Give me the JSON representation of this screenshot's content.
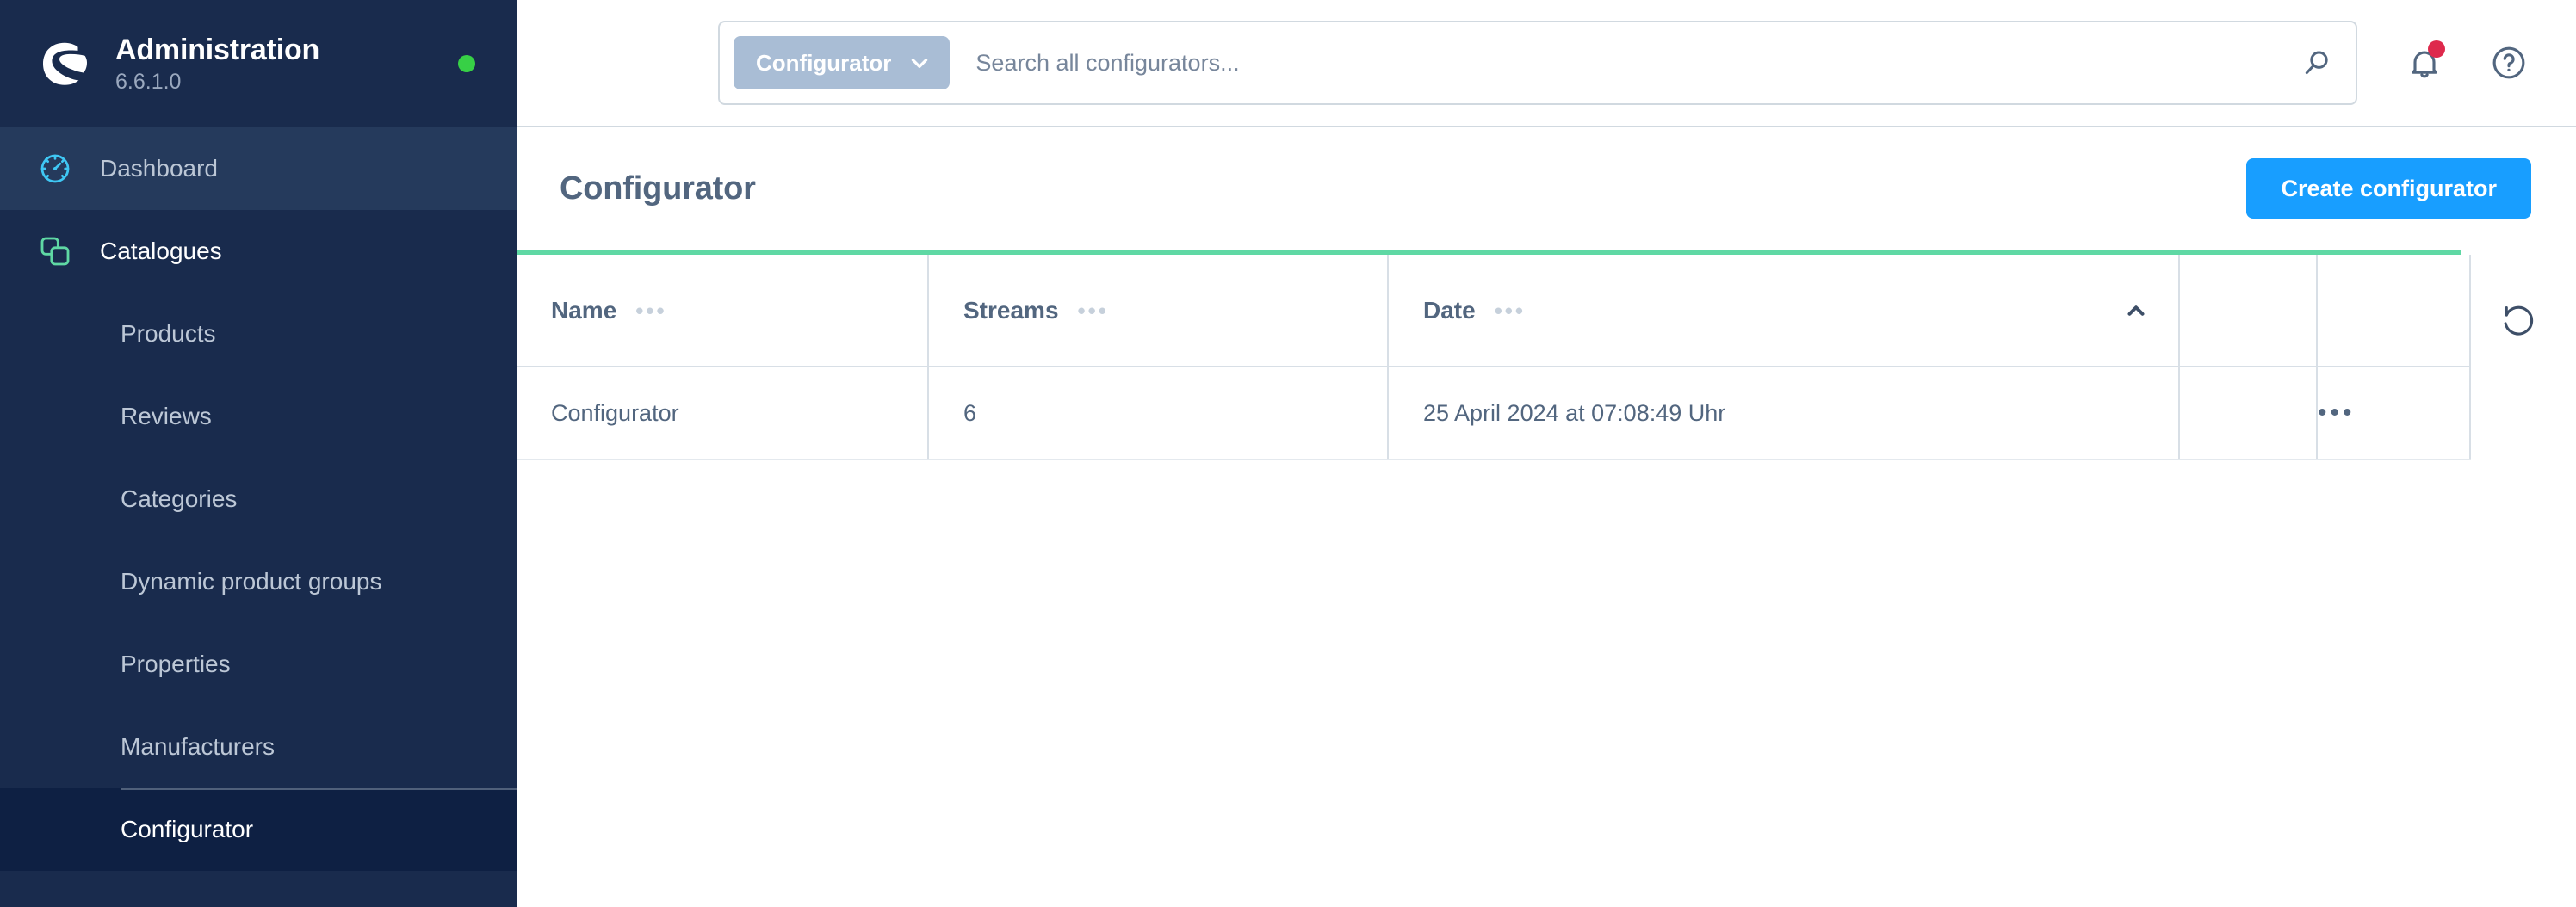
{
  "brand": {
    "title": "Administration",
    "version": "6.6.1.0",
    "logo_icon": "shopware-logo-icon",
    "status_icon": "online-status-dot"
  },
  "sidebar": {
    "items": [
      {
        "label": "Dashboard",
        "icon": "speedometer-icon",
        "level": "top",
        "state": "hovered"
      },
      {
        "label": "Catalogues",
        "icon": "copy-squares-icon",
        "level": "top",
        "state": "parent-active"
      },
      {
        "label": "Products",
        "level": "sub",
        "state": "default"
      },
      {
        "label": "Reviews",
        "level": "sub",
        "state": "default"
      },
      {
        "label": "Categories",
        "level": "sub",
        "state": "default"
      },
      {
        "label": "Dynamic product groups",
        "level": "sub",
        "state": "default"
      },
      {
        "label": "Properties",
        "level": "sub",
        "state": "default"
      },
      {
        "label": "Manufacturers",
        "level": "sub",
        "state": "default"
      },
      {
        "label": "Configurator",
        "level": "sub",
        "state": "active",
        "divider_above": true
      }
    ]
  },
  "topbar": {
    "search": {
      "badge_label": "Configurator",
      "badge_caret_icon": "chevron-down-icon",
      "placeholder": "Search all configurators...",
      "value": "",
      "submit_icon": "search-icon"
    },
    "actions": [
      {
        "name": "notifications",
        "icon": "bell-icon",
        "has_badge": true
      },
      {
        "name": "help",
        "icon": "question-circle-icon",
        "has_badge": false
      }
    ]
  },
  "page": {
    "title": "Configurator",
    "create_button_label": "Create configurator",
    "reset_icon": "refresh-reset-icon"
  },
  "table": {
    "columns": [
      {
        "label": "Name",
        "menu_icon": "column-options-icon",
        "sorted": false
      },
      {
        "label": "Streams",
        "menu_icon": "column-options-icon",
        "sorted": false
      },
      {
        "label": "Date",
        "menu_icon": "column-options-icon",
        "sorted": true,
        "sort_direction": "ascending",
        "sort_icon": "chevron-up-icon"
      }
    ],
    "rows": [
      {
        "name": "Configurator",
        "streams": "6",
        "date": "25 April 2024 at 07:08:49 Uhr",
        "context_menu_icon": "ellipsis-icon"
      }
    ]
  },
  "colors": {
    "sidebar_bg": "#192B4D",
    "sidebar_hover": "#253A5C",
    "sidebar_active": "#0E2043",
    "accent_blue": "#189EFF",
    "table_top_accent": "#5FD8A4",
    "status_green": "#37D046",
    "notification_red": "#DE294C",
    "text_slate": "#52667F",
    "badge_blue_grey": "#A9BDD5"
  }
}
